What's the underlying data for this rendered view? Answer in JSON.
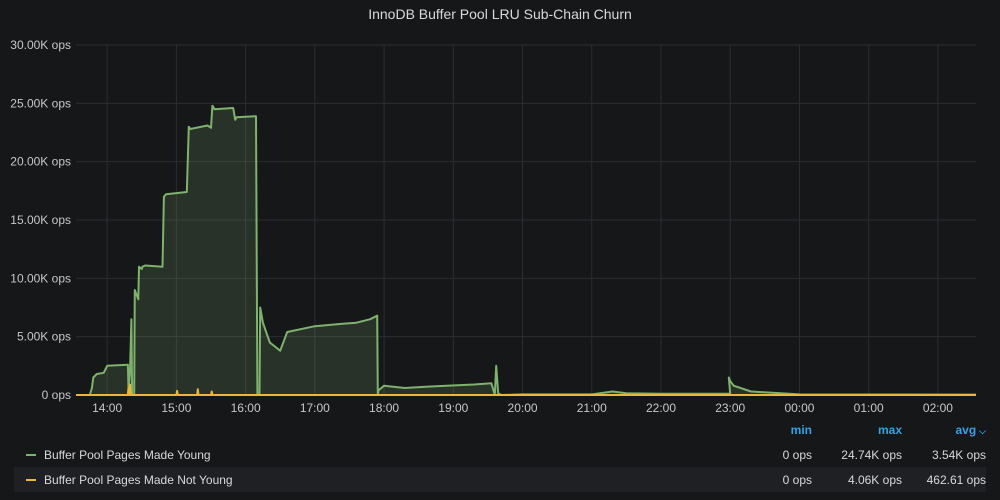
{
  "panel": {
    "title": "InnoDB Buffer Pool LRU Sub-Chain Churn"
  },
  "colors": {
    "background": "#161719",
    "grid": "#2c2d31",
    "young": "#7eb26d",
    "not_young": "#eab839",
    "legend_header": "#33a2e5"
  },
  "legend": {
    "headers": {
      "min": "min",
      "max": "max",
      "avg": "avg"
    },
    "rows": [
      {
        "name": "Buffer Pool Pages Made Young",
        "color": "#7eb26d",
        "min": "0 ops",
        "max": "24.74K ops",
        "avg": "3.54K ops"
      },
      {
        "name": "Buffer Pool Pages Made Not Young",
        "color": "#eab839",
        "min": "0 ops",
        "max": "4.06K ops",
        "avg": "462.61 ops"
      }
    ]
  },
  "chart_data": {
    "type": "area",
    "title": "InnoDB Buffer Pool LRU Sub-Chain Churn",
    "xlabel": "",
    "ylabel": "",
    "ylim": [
      0,
      30000
    ],
    "y_ticks": [
      0,
      5000,
      10000,
      15000,
      20000,
      25000,
      30000
    ],
    "y_tick_labels": [
      "0 ops",
      "5.00K ops",
      "10.00K ops",
      "15.00K ops",
      "20.00K ops",
      "25.00K ops",
      "30.00K ops"
    ],
    "xlim": [
      13.55,
      26.55
    ],
    "x_ticks": [
      14,
      15,
      16,
      17,
      18,
      19,
      20,
      21,
      22,
      23,
      24,
      25,
      26
    ],
    "x_tick_labels": [
      "14:00",
      "15:00",
      "16:00",
      "17:00",
      "18:00",
      "19:00",
      "20:00",
      "21:00",
      "22:00",
      "23:00",
      "00:00",
      "01:00",
      "02:00"
    ],
    "grid": true,
    "legend_position": "bottom",
    "series": [
      {
        "name": "Buffer Pool Pages Made Young",
        "color": "#7eb26d",
        "x": [
          13.55,
          13.75,
          13.78,
          13.8,
          13.85,
          13.95,
          14.0,
          14.3,
          14.31,
          14.3,
          14.33,
          14.35,
          14.36,
          14.39,
          14.4,
          14.45,
          14.46,
          14.5,
          14.51,
          14.55,
          14.8,
          14.82,
          14.85,
          15.15,
          15.18,
          15.2,
          15.45,
          15.5,
          15.52,
          15.55,
          15.82,
          15.85,
          15.87,
          16.15,
          16.17,
          16.2,
          16.21,
          16.25,
          16.35,
          16.5,
          16.6,
          17.0,
          17.4,
          17.6,
          17.8,
          17.9,
          17.91,
          17.92,
          18.0,
          18.3,
          18.6,
          18.9,
          19.3,
          19.55,
          19.6,
          19.62,
          19.65,
          19.66,
          19.7,
          20.0,
          21.0,
          21.3,
          21.5,
          22.0,
          23.0,
          22.98,
          23.0,
          23.05,
          23.3,
          24.0,
          26.55
        ],
        "values": [
          0,
          0,
          600,
          1500,
          1800,
          1900,
          2500,
          2600,
          0,
          0,
          2000,
          6500,
          0,
          0,
          9000,
          8200,
          11000,
          10800,
          11000,
          11100,
          11000,
          17000,
          17200,
          17400,
          23000,
          22800,
          23100,
          22900,
          24800,
          24500,
          24600,
          23600,
          23800,
          23900,
          0,
          0,
          7500,
          6200,
          4500,
          3800,
          5400,
          5900,
          6100,
          6200,
          6500,
          6800,
          0,
          400,
          800,
          600,
          700,
          800,
          900,
          1000,
          0,
          2500,
          0,
          100,
          0,
          50,
          50,
          300,
          150,
          100,
          100,
          1500,
          1200,
          800,
          300,
          50,
          30
        ]
      },
      {
        "name": "Buffer Pool Pages Made Not Young",
        "color": "#eab839",
        "x": [
          13.55,
          13.65,
          13.7,
          14.0,
          14.3,
          14.31,
          14.32,
          14.33,
          14.34,
          14.5,
          15.0,
          15.01,
          15.02,
          15.3,
          15.31,
          15.32,
          15.5,
          15.51,
          15.52,
          15.8,
          16.0,
          26.55
        ],
        "values": [
          0,
          0,
          0,
          0,
          0,
          600,
          0,
          900,
          0,
          0,
          0,
          350,
          0,
          0,
          500,
          0,
          0,
          300,
          0,
          0,
          0,
          0
        ]
      }
    ]
  }
}
